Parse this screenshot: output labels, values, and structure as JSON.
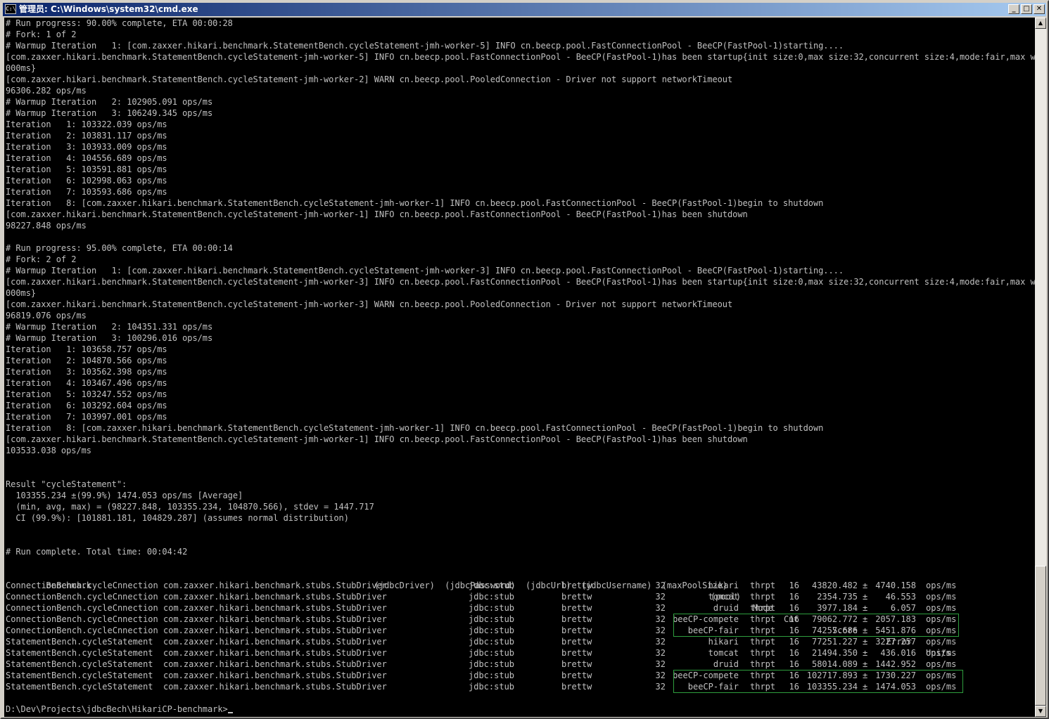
{
  "window": {
    "title": "管理员: C:\\Windows\\system32\\cmd.exe",
    "icon_label": "C:\\"
  },
  "controls": {
    "minimize": "_",
    "maximize": "□",
    "close": "✕"
  },
  "scrollbar": {
    "up": "▲",
    "down": "▼"
  },
  "log_lines": [
    "# Run progress: 90.00% complete, ETA 00:00:28",
    "# Fork: 1 of 2",
    "# Warmup Iteration   1: [com.zaxxer.hikari.benchmark.StatementBench.cycleStatement-jmh-worker-5] INFO cn.beecp.pool.FastConnectionPool - BeeCP(FastPool-1)starting....",
    "[com.zaxxer.hikari.benchmark.StatementBench.cycleStatement-jmh-worker-5] INFO cn.beecp.pool.FastConnectionPool - BeeCP(FastPool-1)has been startup{init size:0,max size:32,concurrent size:4,mode:fair,max wait:8",
    "000ms}",
    "[com.zaxxer.hikari.benchmark.StatementBench.cycleStatement-jmh-worker-2] WARN cn.beecp.pool.PooledConnection - Driver not support networkTimeout",
    "96306.282 ops/ms",
    "# Warmup Iteration   2: 102905.091 ops/ms",
    "# Warmup Iteration   3: 106249.345 ops/ms",
    "Iteration   1: 103322.039 ops/ms",
    "Iteration   2: 103831.117 ops/ms",
    "Iteration   3: 103933.009 ops/ms",
    "Iteration   4: 104556.689 ops/ms",
    "Iteration   5: 103591.881 ops/ms",
    "Iteration   6: 102998.063 ops/ms",
    "Iteration   7: 103593.686 ops/ms",
    "Iteration   8: [com.zaxxer.hikari.benchmark.StatementBench.cycleStatement-jmh-worker-1] INFO cn.beecp.pool.FastConnectionPool - BeeCP(FastPool-1)begin to shutdown",
    "[com.zaxxer.hikari.benchmark.StatementBench.cycleStatement-jmh-worker-1] INFO cn.beecp.pool.FastConnectionPool - BeeCP(FastPool-1)has been shutdown",
    "98227.848 ops/ms",
    "",
    "# Run progress: 95.00% complete, ETA 00:00:14",
    "# Fork: 2 of 2",
    "# Warmup Iteration   1: [com.zaxxer.hikari.benchmark.StatementBench.cycleStatement-jmh-worker-3] INFO cn.beecp.pool.FastConnectionPool - BeeCP(FastPool-1)starting....",
    "[com.zaxxer.hikari.benchmark.StatementBench.cycleStatement-jmh-worker-3] INFO cn.beecp.pool.FastConnectionPool - BeeCP(FastPool-1)has been startup{init size:0,max size:32,concurrent size:4,mode:fair,max wait:8",
    "000ms}",
    "[com.zaxxer.hikari.benchmark.StatementBench.cycleStatement-jmh-worker-3] WARN cn.beecp.pool.PooledConnection - Driver not support networkTimeout",
    "96819.076 ops/ms",
    "# Warmup Iteration   2: 104351.331 ops/ms",
    "# Warmup Iteration   3: 100296.016 ops/ms",
    "Iteration   1: 103658.757 ops/ms",
    "Iteration   2: 104870.566 ops/ms",
    "Iteration   3: 103562.398 ops/ms",
    "Iteration   4: 103467.496 ops/ms",
    "Iteration   5: 103247.552 ops/ms",
    "Iteration   6: 103292.604 ops/ms",
    "Iteration   7: 103997.001 ops/ms",
    "Iteration   8: [com.zaxxer.hikari.benchmark.StatementBench.cycleStatement-jmh-worker-1] INFO cn.beecp.pool.FastConnectionPool - BeeCP(FastPool-1)begin to shutdown",
    "[com.zaxxer.hikari.benchmark.StatementBench.cycleStatement-jmh-worker-1] INFO cn.beecp.pool.FastConnectionPool - BeeCP(FastPool-1)has been shutdown",
    "103533.038 ops/ms",
    "",
    "",
    "Result \"cycleStatement\":",
    "  103355.234 ±(99.9%) 1474.053 ops/ms [Average]",
    "  (min, avg, max) = (98227.848, 103355.234, 104870.566), stdev = 1447.717",
    "  CI (99.9%): [101881.181, 104829.287] (assumes normal distribution)",
    "",
    "",
    "# Run complete. Total time: 00:04:42",
    ""
  ],
  "results_table": {
    "header_line": "Benchmark                                                        (jdbcDriver)  (jdbcPassword)  (jdbcUrl)  (jdbcUsername)  (maxPoolSize)",
    "columns": {
      "pool": "(pool)",
      "mode": "Mode",
      "cnt": "Cnt",
      "score": "Score",
      "error": "Error",
      "units": "Units"
    },
    "rows": [
      {
        "benchmark": "ConnectionBench.cycleCnnection",
        "driver": "com.zaxxer.hikari.benchmark.stubs.StubDriver",
        "url": "jdbc:stub",
        "user": "brettw",
        "max": "32",
        "pool": "hikari",
        "mode": "thrpt",
        "cnt": "16",
        "score": "43820.482",
        "pm": "±",
        "error": "4740.158",
        "units": "ops/ms"
      },
      {
        "benchmark": "ConnectionBench.cycleCnnection",
        "driver": "com.zaxxer.hikari.benchmark.stubs.StubDriver",
        "url": "jdbc:stub",
        "user": "brettw",
        "max": "32",
        "pool": "tomcat",
        "mode": "thrpt",
        "cnt": "16",
        "score": "2354.735",
        "pm": "±",
        "error": "46.553",
        "units": "ops/ms"
      },
      {
        "benchmark": "ConnectionBench.cycleCnnection",
        "driver": "com.zaxxer.hikari.benchmark.stubs.StubDriver",
        "url": "jdbc:stub",
        "user": "brettw",
        "max": "32",
        "pool": "druid",
        "mode": "thrpt",
        "cnt": "16",
        "score": "3977.184",
        "pm": "±",
        "error": "6.057",
        "units": "ops/ms"
      },
      {
        "benchmark": "ConnectionBench.cycleCnnection",
        "driver": "com.zaxxer.hikari.benchmark.stubs.StubDriver",
        "url": "jdbc:stub",
        "user": "brettw",
        "max": "32",
        "pool": "beeCP-compete",
        "mode": "thrpt",
        "cnt": "16",
        "score": "79062.772",
        "pm": "±",
        "error": "2057.183",
        "units": "ops/ms"
      },
      {
        "benchmark": "ConnectionBench.cycleCnnection",
        "driver": "com.zaxxer.hikari.benchmark.stubs.StubDriver",
        "url": "jdbc:stub",
        "user": "brettw",
        "max": "32",
        "pool": "beeCP-fair",
        "mode": "thrpt",
        "cnt": "16",
        "score": "74257.686",
        "pm": "±",
        "error": "5451.876",
        "units": "ops/ms"
      },
      {
        "benchmark": "StatementBench.cycleStatement",
        "driver": "com.zaxxer.hikari.benchmark.stubs.StubDriver",
        "url": "jdbc:stub",
        "user": "brettw",
        "max": "32",
        "pool": "hikari",
        "mode": "thrpt",
        "cnt": "16",
        "score": "77251.227",
        "pm": "±",
        "error": "3227.257",
        "units": "ops/ms"
      },
      {
        "benchmark": "StatementBench.cycleStatement",
        "driver": "com.zaxxer.hikari.benchmark.stubs.StubDriver",
        "url": "jdbc:stub",
        "user": "brettw",
        "max": "32",
        "pool": "tomcat",
        "mode": "thrpt",
        "cnt": "16",
        "score": "21494.350",
        "pm": "±",
        "error": "436.016",
        "units": "ops/ms"
      },
      {
        "benchmark": "StatementBench.cycleStatement",
        "driver": "com.zaxxer.hikari.benchmark.stubs.StubDriver",
        "url": "jdbc:stub",
        "user": "brettw",
        "max": "32",
        "pool": "druid",
        "mode": "thrpt",
        "cnt": "16",
        "score": "58014.089",
        "pm": "±",
        "error": "1442.952",
        "units": "ops/ms"
      },
      {
        "benchmark": "StatementBench.cycleStatement",
        "driver": "com.zaxxer.hikari.benchmark.stubs.StubDriver",
        "url": "jdbc:stub",
        "user": "brettw",
        "max": "32",
        "pool": "beeCP-compete",
        "mode": "thrpt",
        "cnt": "16",
        "score": "102717.893",
        "pm": "±",
        "error": "1730.227",
        "units": "ops/ms"
      },
      {
        "benchmark": "StatementBench.cycleStatement",
        "driver": "com.zaxxer.hikari.benchmark.stubs.StubDriver",
        "url": "jdbc:stub",
        "user": "brettw",
        "max": "32",
        "pool": "beeCP-fair",
        "mode": "thrpt",
        "cnt": "16",
        "score": "103355.234",
        "pm": "±",
        "error": "1474.053",
        "units": "ops/ms"
      }
    ]
  },
  "prompt": "D:\\Dev\\Projects\\jdbcBech\\HikariCP-benchmark>",
  "colors": {
    "background": "#000000",
    "text": "#c0c0c0",
    "highlight_box": "#2e9e3e"
  }
}
